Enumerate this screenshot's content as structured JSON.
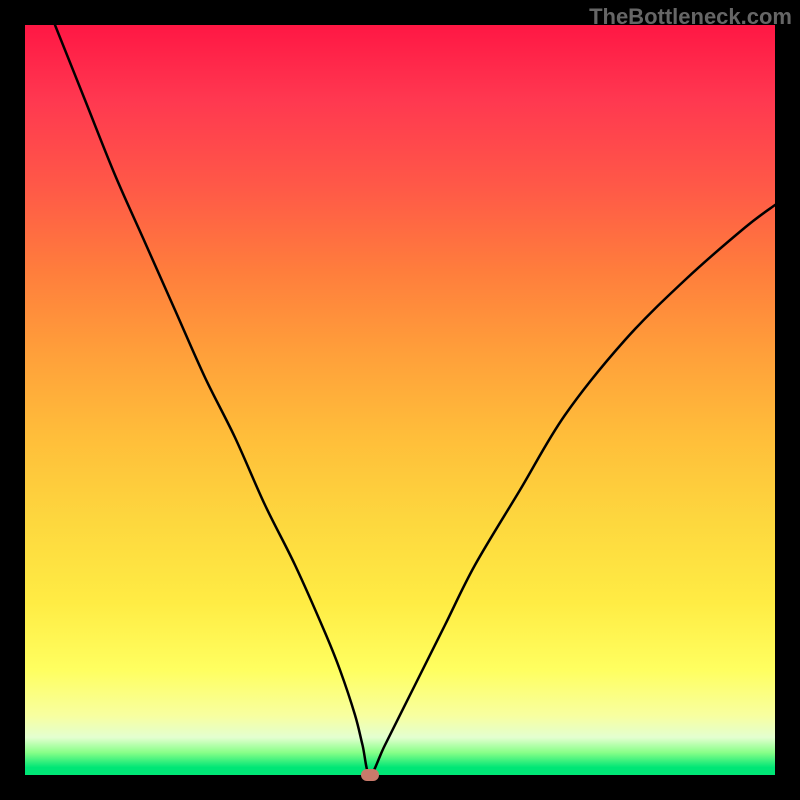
{
  "watermark": "TheBottleneck.com",
  "chart_data": {
    "type": "line",
    "title": "",
    "xlabel": "",
    "ylabel": "",
    "xlim": [
      0,
      100
    ],
    "ylim": [
      0,
      100
    ],
    "curve": {
      "x": [
        4,
        8,
        12,
        16,
        20,
        24,
        28,
        32,
        36,
        40,
        42,
        44,
        45,
        46,
        48,
        52,
        56,
        60,
        66,
        72,
        80,
        88,
        96,
        100
      ],
      "y": [
        100,
        90,
        80,
        71,
        62,
        53,
        45,
        36,
        28,
        19,
        14,
        8,
        4,
        0,
        4,
        12,
        20,
        28,
        38,
        48,
        58,
        66,
        73,
        76
      ]
    },
    "marker": {
      "x": 46,
      "y": 0,
      "color": "#C97A6B"
    },
    "gradient_stops": [
      {
        "pos": 0,
        "color": "#FF1744"
      },
      {
        "pos": 50,
        "color": "#FFC83A"
      },
      {
        "pos": 90,
        "color": "#FFFF60"
      },
      {
        "pos": 100,
        "color": "#00E676"
      }
    ]
  }
}
